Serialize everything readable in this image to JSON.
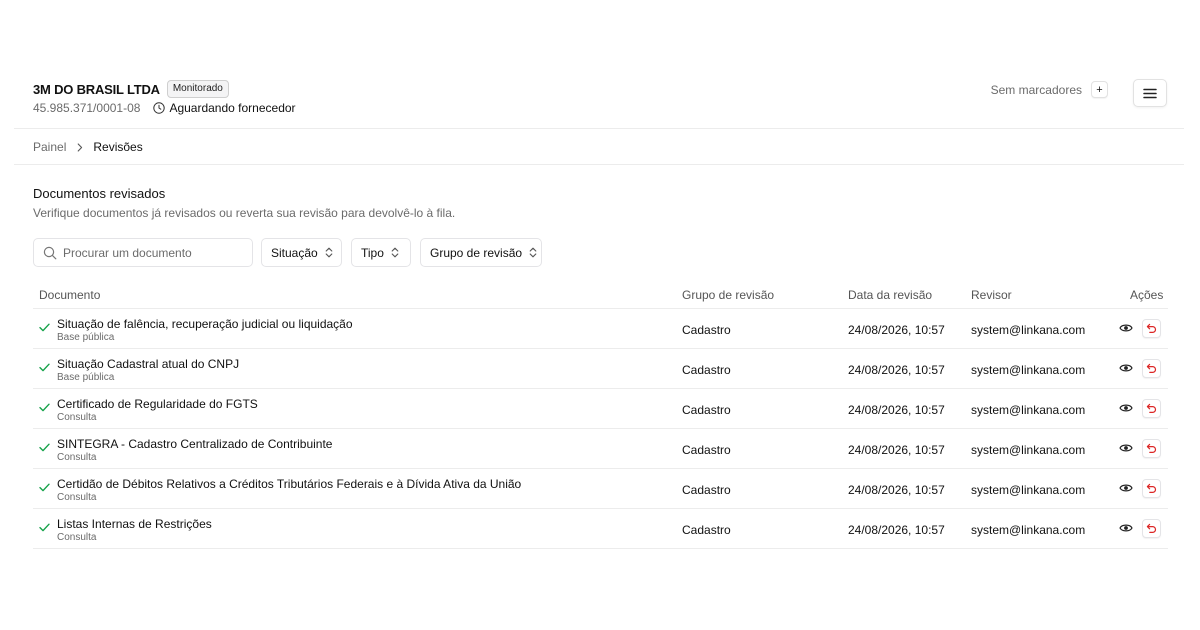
{
  "company": {
    "name": "3M DO BRASIL LTDA",
    "badge": "Monitorado",
    "cnpj": "45.985.371/0001-08",
    "status": "Aguardando fornecedor"
  },
  "markers": {
    "label": "Sem marcadores",
    "add_label": "+"
  },
  "breadcrumb": {
    "root": "Painel",
    "current": "Revisões"
  },
  "section": {
    "title": "Documentos revisados",
    "description": "Verifique documentos já revisados ou reverta sua revisão para devolvê-lo à fila."
  },
  "filters": {
    "search_placeholder": "Procurar um documento",
    "situacao": "Situação",
    "tipo": "Tipo",
    "grupo": "Grupo de revisão"
  },
  "table": {
    "headers": {
      "documento": "Documento",
      "grupo": "Grupo de revisão",
      "data": "Data da revisão",
      "revisor": "Revisor",
      "acoes": "Ações"
    },
    "rows": [
      {
        "title": "Situação de falência, recuperação judicial ou liquidação",
        "source": "Base pública",
        "group": "Cadastro",
        "date": "24/08/2026, 10:57",
        "reviewer": "system@linkana.com"
      },
      {
        "title": "Situação Cadastral atual do CNPJ",
        "source": "Base pública",
        "group": "Cadastro",
        "date": "24/08/2026, 10:57",
        "reviewer": "system@linkana.com"
      },
      {
        "title": "Certificado de Regularidade do FGTS",
        "source": "Consulta",
        "group": "Cadastro",
        "date": "24/08/2026, 10:57",
        "reviewer": "system@linkana.com"
      },
      {
        "title": "SINTEGRA - Cadastro Centralizado de Contribuinte",
        "source": "Consulta",
        "group": "Cadastro",
        "date": "24/08/2026, 10:57",
        "reviewer": "system@linkana.com"
      },
      {
        "title": "Certidão de Débitos Relativos a Créditos Tributários Federais e à Dívida Ativa da União",
        "source": "Consulta",
        "group": "Cadastro",
        "date": "24/08/2026, 10:57",
        "reviewer": "system@linkana.com"
      },
      {
        "title": "Listas Internas de Restrições",
        "source": "Consulta",
        "group": "Cadastro",
        "date": "24/08/2026, 10:57",
        "reviewer": "system@linkana.com"
      }
    ]
  },
  "colors": {
    "check": "#16a34a",
    "undo": "#dc2626",
    "muted": "#6b6b6b",
    "border": "#ececec"
  }
}
